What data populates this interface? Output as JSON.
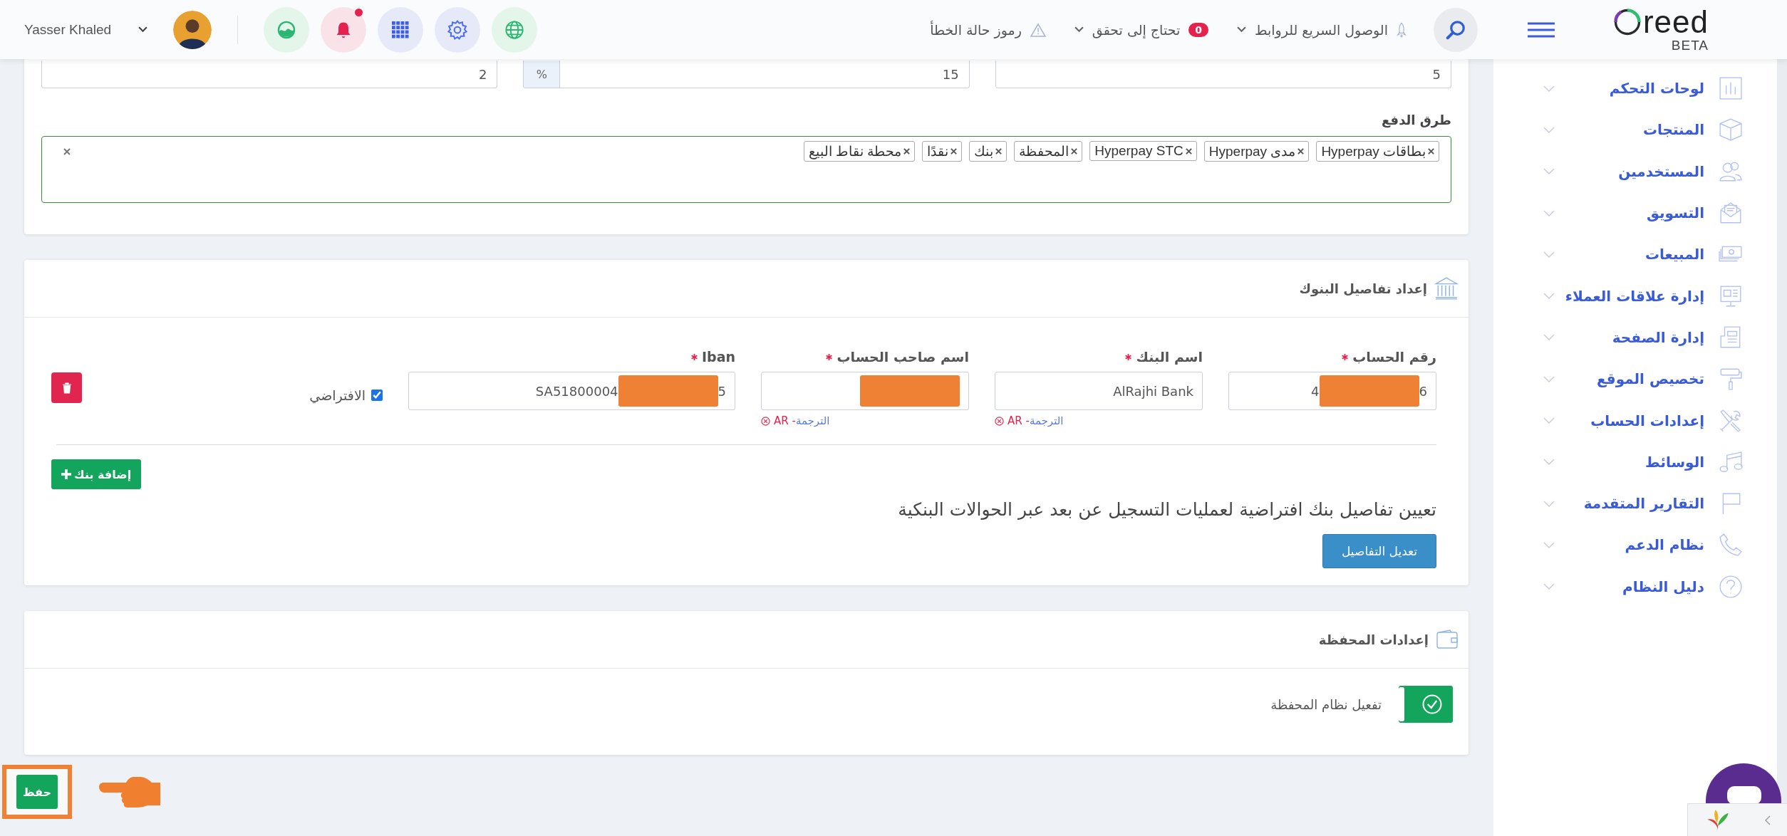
{
  "header": {
    "logo": {
      "text": "reed",
      "badge": "BETA"
    },
    "quick_links": "الوصول السريع للروابط",
    "verify": {
      "label": "تحتاج إلى تحقق",
      "count": "0"
    },
    "error_codes": "رموز حالة الخطأ",
    "notifications": {
      "unread": true
    },
    "user": {
      "name": "Yasser Khaled"
    }
  },
  "sidebar": {
    "items": [
      {
        "label": "لوحات التحكم",
        "kind": "chart"
      },
      {
        "label": "المنتجات",
        "kind": "box"
      },
      {
        "label": "المستخدمين",
        "kind": "users"
      },
      {
        "label": "التسويق",
        "kind": "mail"
      },
      {
        "label": "المبيعات",
        "kind": "money"
      },
      {
        "label": "إدارة علاقات العملاء",
        "kind": "board"
      },
      {
        "label": "إدارة الصفحة",
        "kind": "document"
      },
      {
        "label": "تخصيص الموقع",
        "kind": "roller"
      },
      {
        "label": "إعدادات الحساب",
        "kind": "tools"
      },
      {
        "label": "الوسائط",
        "kind": "music"
      },
      {
        "label": "التقارير المتقدمة",
        "kind": "flag"
      },
      {
        "label": "نظام الدعم",
        "kind": "phone"
      },
      {
        "label": "دليل النظام",
        "kind": "help"
      }
    ]
  },
  "settings_card": {
    "inputs": [
      {
        "value": "5"
      },
      {
        "value": "15",
        "prefix": "%"
      },
      {
        "value": "2"
      }
    ],
    "payment_methods": {
      "label": "طرق الدفع",
      "tags": [
        "بطاقات Hyperpay",
        "مدى Hyperpay",
        "Hyperpay STC",
        "المحفظة",
        "بنك",
        "نقدًا",
        "محطة نقاط البيع"
      ]
    }
  },
  "banks_card": {
    "title": "إعداد تفاصيل البنوك",
    "fields": [
      {
        "label": "رقم الحساب",
        "required": true,
        "value_start": "4",
        "value_end": "6",
        "redacted": true
      },
      {
        "label": "اسم البنك",
        "required": true,
        "value_start": "AlRajhi Bank",
        "translation": {
          "label": "الترجمة",
          "lang": "- AR"
        }
      },
      {
        "label": "اسم صاحب الحساب",
        "required": true,
        "redacted": true,
        "translation": {
          "label": "الترجمة",
          "lang": "- AR"
        }
      },
      {
        "label": "Iban",
        "required": true,
        "value_start": "SA51800004",
        "value_end": "5",
        "redacted": true
      }
    ],
    "default": {
      "label": "الافتراضي",
      "checked": true
    },
    "add_button": "إضافة بنك",
    "description": "تعيين تفاصيل بنك افتراضية لعمليات التسجيل عن بعد عبر الحوالات البنكية",
    "edit_button": "تعديل التفاصيل"
  },
  "wallet_card": {
    "title": "إعدادات المحفظة",
    "toggle": {
      "label": "تفعيل نظام المحفظة",
      "on": true
    }
  },
  "save_button": {
    "label": "حفظ",
    "highlighted": true
  }
}
